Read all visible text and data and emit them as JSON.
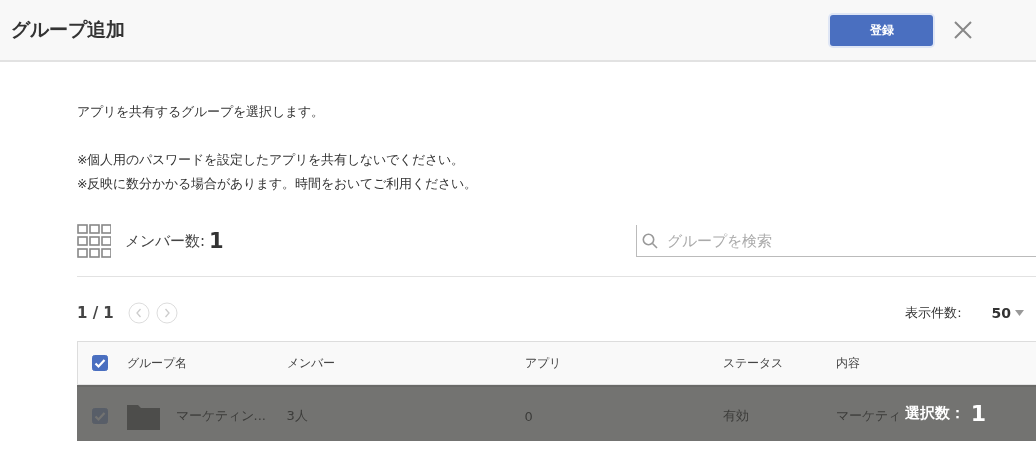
{
  "header": {
    "title": "グループ追加",
    "submit_label": "登録"
  },
  "intro": [
    "アプリを共有するグループを選択します。",
    "※個人用のパスワードを設定したアプリを共有しないでください。",
    "※反映に数分かかる場合があります。時間をおいてご利用ください。"
  ],
  "members": {
    "label": "メンバー数:",
    "count": "1"
  },
  "search": {
    "placeholder": "グループを検索"
  },
  "pager": {
    "page": "1 / 1",
    "page_size_label": "表示件数:",
    "page_size": "50"
  },
  "table": {
    "select_all_checked": true,
    "columns": [
      "グループ名",
      "メンバー",
      "アプリ",
      "ステータス",
      "内容"
    ],
    "rows": [
      {
        "checked": true,
        "cells": [
          "マーケティン...",
          "3人",
          "0",
          "有効",
          "マーケティ"
        ]
      }
    ]
  },
  "selection_bar": {
    "label": "選択数：",
    "count": "1"
  }
}
